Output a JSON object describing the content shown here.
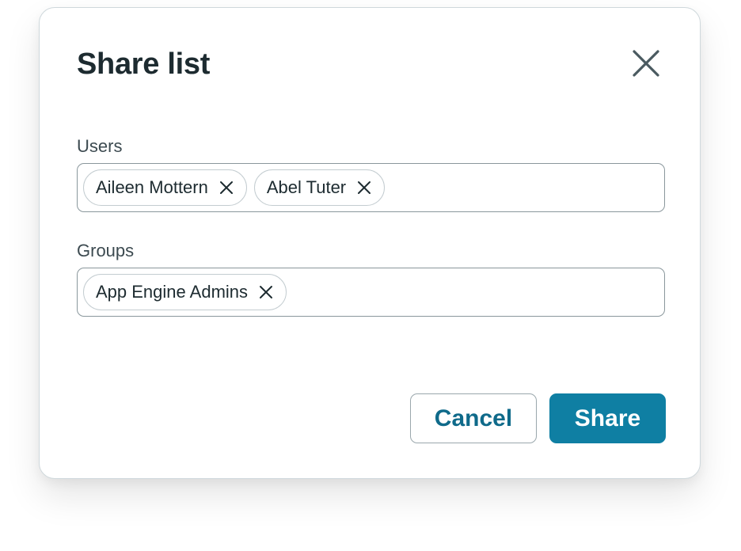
{
  "dialog": {
    "title": "Share list",
    "close_icon": "close-icon"
  },
  "users": {
    "label": "Users",
    "pills": [
      {
        "label": "Aileen Mottern",
        "remove_icon": "close-icon"
      },
      {
        "label": "Abel Tuter",
        "remove_icon": "close-icon"
      }
    ]
  },
  "groups": {
    "label": "Groups",
    "pills": [
      {
        "label": "App Engine Admins",
        "remove_icon": "close-icon"
      }
    ]
  },
  "actions": {
    "cancel_label": "Cancel",
    "share_label": "Share"
  },
  "colors": {
    "primary": "#0f7fa3",
    "primary_text": "#0f6a8a",
    "title_text": "#1d2b30",
    "icon": "#4a5a60"
  }
}
